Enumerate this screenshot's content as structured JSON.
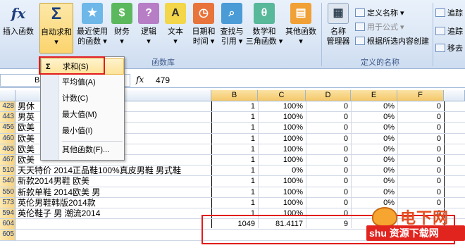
{
  "ribbon": {
    "buttons": [
      {
        "label1": "插入函数",
        "label2": "",
        "icon": "fx-icon"
      },
      {
        "label1": "自动求和",
        "label2": "▾",
        "icon": "sigma-icon"
      },
      {
        "label1": "最近使用",
        "label2": "的函数 ▾",
        "icon": "star-book-icon"
      },
      {
        "label1": "财务",
        "label2": "▾",
        "icon": "finance-book-icon"
      },
      {
        "label1": "逻辑",
        "label2": "▾",
        "icon": "logic-book-icon"
      },
      {
        "label1": "文本",
        "label2": "▾",
        "icon": "text-book-icon"
      },
      {
        "label1": "日期和",
        "label2": "时间 ▾",
        "icon": "datetime-book-icon"
      },
      {
        "label1": "查找与",
        "label2": "引用 ▾",
        "icon": "lookup-book-icon"
      },
      {
        "label1": "数学和",
        "label2": "三角函数 ▾",
        "icon": "math-book-icon"
      },
      {
        "label1": "其他函数",
        "label2": "▾",
        "icon": "other-book-icon"
      },
      {
        "label1": "名称",
        "label2": "管理器",
        "icon": "name-manager-icon"
      }
    ],
    "group_library": "函数库",
    "group_names": "定义的名称",
    "define_name": "定义名称 ▾",
    "use_in_formula": "用于公式 ▾",
    "create_from_selection": "根据所选内容创建",
    "trace1": "追踪",
    "trace2": "追踪",
    "remove": "移去",
    "sigma": "Σ",
    "fx": "fx"
  },
  "formula_bar": {
    "name_box": "B",
    "fx_label": "fx",
    "value": "479"
  },
  "menu": {
    "items": [
      {
        "icon": "Σ",
        "label": "求和(S)"
      },
      {
        "icon": "",
        "label": "平均值(A)"
      },
      {
        "icon": "",
        "label": "计数(C)"
      },
      {
        "icon": "",
        "label": "最大值(M)"
      },
      {
        "icon": "",
        "label": "最小值(I)"
      },
      {
        "icon": "",
        "label": "其他函数(F)..."
      }
    ]
  },
  "grid": {
    "columns": [
      "B",
      "C",
      "D",
      "E",
      "F"
    ],
    "rows": [
      {
        "num": "428",
        "a": "男休",
        "b": "1",
        "c": "100%",
        "d": "0",
        "e": "0%",
        "f": "0"
      },
      {
        "num": "443",
        "a": "男英",
        "b": "1",
        "c": "100%",
        "d": "0",
        "e": "0%",
        "f": "0"
      },
      {
        "num": "456",
        "a": "欧美",
        "b": "1",
        "c": "100%",
        "d": "0",
        "e": "0%",
        "f": "0"
      },
      {
        "num": "460",
        "a": "欧美",
        "b": "1",
        "c": "100%",
        "d": "0",
        "e": "0%",
        "f": "0"
      },
      {
        "num": "465",
        "a": "欧美",
        "b": "1",
        "c": "100%",
        "d": "0",
        "e": "0%",
        "f": "0"
      },
      {
        "num": "467",
        "a": "欧美",
        "b": "1",
        "c": "100%",
        "d": "0",
        "e": "0%",
        "f": "0"
      },
      {
        "num": "510",
        "a": "天天特价 2014正品鞋100%真皮男鞋 男式鞋",
        "b": "1",
        "c": "0%",
        "d": "0",
        "e": "0%",
        "f": "0"
      },
      {
        "num": "540",
        "a": "新款2014男鞋 欧美",
        "b": "1",
        "c": "100%",
        "d": "0",
        "e": "0%",
        "f": "0"
      },
      {
        "num": "550",
        "a": "新款单鞋 2014欧美 男",
        "b": "1",
        "c": "100%",
        "d": "0",
        "e": "0%",
        "f": "0"
      },
      {
        "num": "573",
        "a": "英伦男鞋韩版2014款",
        "b": "1",
        "c": "100%",
        "d": "0",
        "e": "0%",
        "f": "0"
      },
      {
        "num": "594",
        "a": "英伦鞋子 男 潮流2014",
        "b": "1",
        "c": "100%",
        "d": "0",
        "e": "0%",
        "f": "0"
      },
      {
        "num": "604",
        "a": "",
        "b": "1049",
        "c": "81.4117",
        "d": "9",
        "e": "",
        "f": ""
      },
      {
        "num": "605",
        "a": "",
        "b": "",
        "c": "",
        "d": "",
        "e": "",
        "f": ""
      }
    ]
  },
  "watermark": {
    "line1": "电下网",
    "line2": "shu 资源下载网"
  }
}
